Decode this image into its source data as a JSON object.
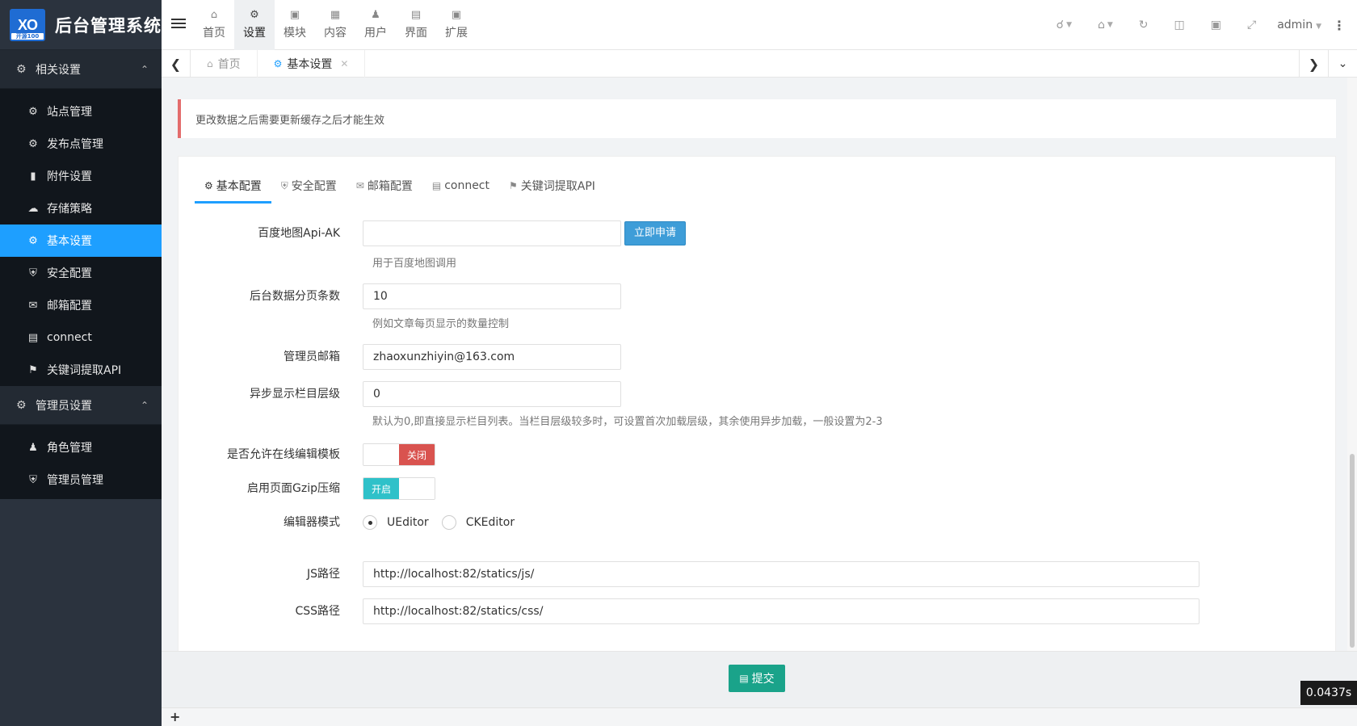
{
  "brand": {
    "logo_text": "XO",
    "logo_sub": "开源100",
    "title": "后台管理系统"
  },
  "topnav": {
    "items": [
      {
        "label": "首页",
        "icon": "home-icon"
      },
      {
        "label": "设置",
        "icon": "cogs-icon"
      },
      {
        "label": "模块",
        "icon": "puzzle-icon"
      },
      {
        "label": "内容",
        "icon": "grid-icon"
      },
      {
        "label": "用户",
        "icon": "user-icon"
      },
      {
        "label": "界面",
        "icon": "html5-icon"
      },
      {
        "label": "扩展",
        "icon": "puzzle-icon"
      }
    ],
    "active_index": 1,
    "user": "admin"
  },
  "sidebar": {
    "groups": [
      {
        "title": "相关设置",
        "items": [
          {
            "label": "站点管理",
            "icon": "cog-icon"
          },
          {
            "label": "发布点管理",
            "icon": "cogs-icon"
          },
          {
            "label": "附件设置",
            "icon": "folder-icon"
          },
          {
            "label": "存储策略",
            "icon": "cloud-icon"
          },
          {
            "label": "基本设置",
            "icon": "cog-icon",
            "active": true
          },
          {
            "label": "安全配置",
            "icon": "shield-icon"
          },
          {
            "label": "邮箱配置",
            "icon": "envelope-icon"
          },
          {
            "label": "connect",
            "icon": "html5-icon"
          },
          {
            "label": "关键词提取API",
            "icon": "tags-icon"
          }
        ]
      },
      {
        "title": "管理员设置",
        "items": [
          {
            "label": "角色管理",
            "icon": "users-icon"
          },
          {
            "label": "管理员管理",
            "icon": "shield-icon"
          }
        ]
      }
    ]
  },
  "tabstrip": {
    "tabs": [
      {
        "label": "首页",
        "icon": "home-icon"
      },
      {
        "label": "基本设置",
        "icon": "cog-icon",
        "active": true
      }
    ]
  },
  "notice": "更改数据之后需要更新缓存之后才能生效",
  "form_tabs": [
    {
      "label": "基本配置",
      "icon": "cog-icon",
      "active": true
    },
    {
      "label": "安全配置",
      "icon": "shield-icon"
    },
    {
      "label": "邮箱配置",
      "icon": "envelope-icon"
    },
    {
      "label": "connect",
      "icon": "html5-icon"
    },
    {
      "label": "关键词提取API",
      "icon": "tags-icon"
    }
  ],
  "form": {
    "baidu_ak": {
      "label": "百度地图Api-AK",
      "value": "",
      "apply_button": "立即申请",
      "help": "用于百度地图调用"
    },
    "page_size": {
      "label": "后台数据分页条数",
      "value": "10",
      "help": "例如文章每页显示的数量控制"
    },
    "admin_email": {
      "label": "管理员邮箱",
      "value": "zhaoxunzhiyin@163.com"
    },
    "async_level": {
      "label": "异步显示栏目层级",
      "value": "0",
      "help": "默认为0,即直接显示栏目列表。当栏目层级较多时，可设置首次加载层级，其余使用异步加载，一般设置为2-3"
    },
    "online_edit": {
      "label": "是否允许在线编辑模板",
      "state_label": "关闭",
      "value": false
    },
    "gzip": {
      "label": "启用页面Gzip压缩",
      "state_label": "开启",
      "value": true
    },
    "editor": {
      "label": "编辑器模式",
      "options": [
        "UEditor",
        "CKEditor"
      ],
      "selected": "UEditor"
    },
    "js_path": {
      "label": "JS路径",
      "value": "http://localhost:82/statics/js/"
    },
    "css_path": {
      "label": "CSS路径",
      "value": "http://localhost:82/statics/css/"
    }
  },
  "actions": {
    "submit": "提交"
  },
  "timer": "0.0437s",
  "colors": {
    "accent": "#1e9fff",
    "sidebar_bg": "#2b333e",
    "submit": "#1aa38a",
    "switch_off": "#d9534f",
    "switch_on": "#2fc1c9"
  }
}
